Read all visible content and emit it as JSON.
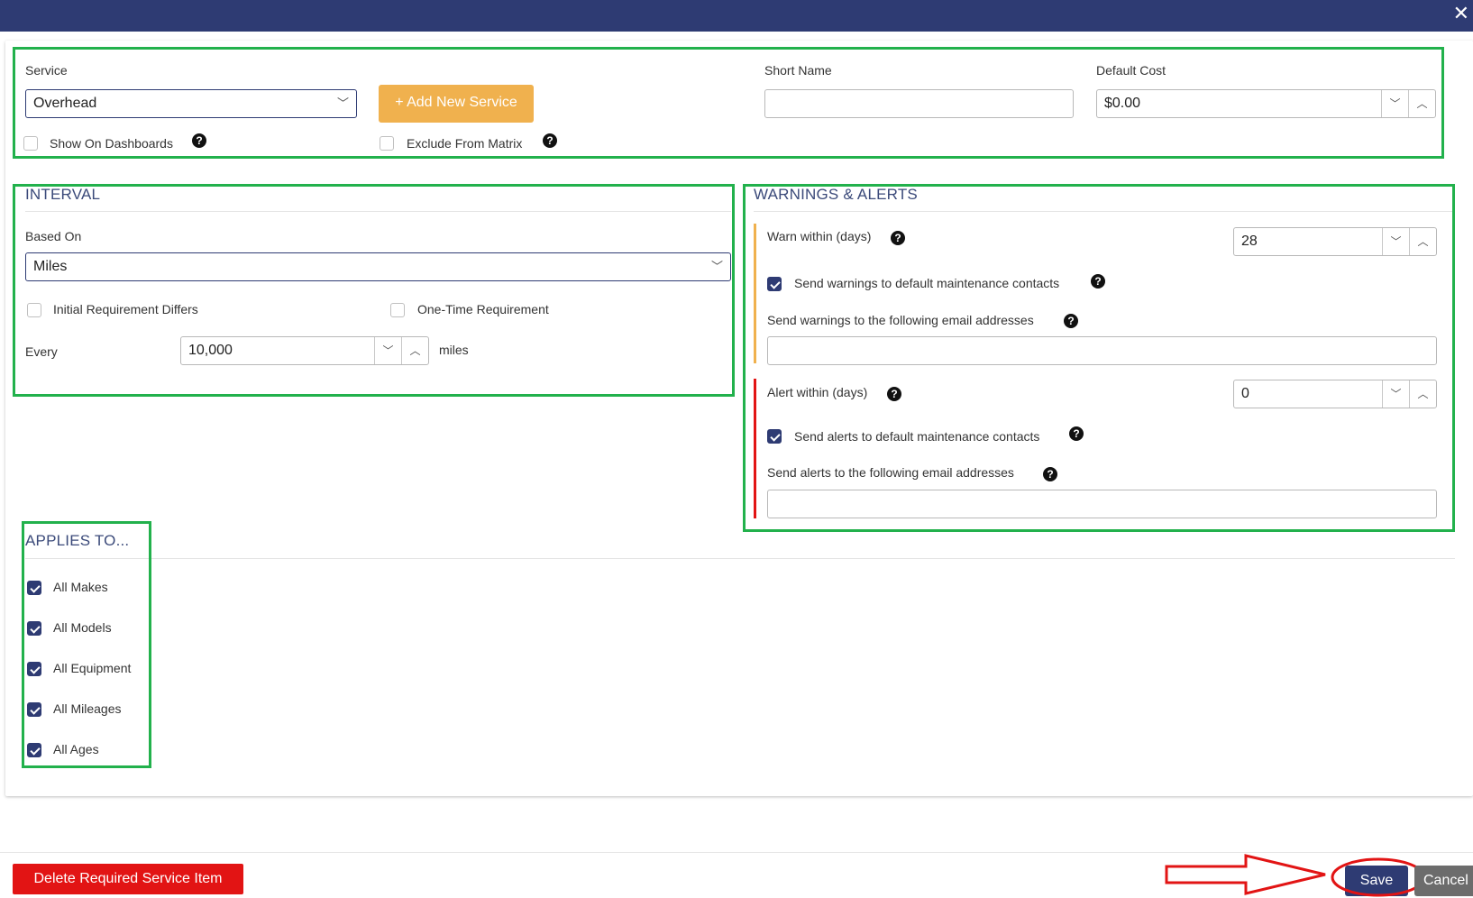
{
  "close_glyph": "✕",
  "service": {
    "label": "Service",
    "value": "Overhead",
    "add_button": "+ Add New Service",
    "short_name_label": "Short Name",
    "short_name_value": "",
    "default_cost_label": "Default Cost",
    "default_cost_value": "$0.00",
    "show_on_dashboards": "Show On Dashboards",
    "exclude_from_matrix": "Exclude From Matrix"
  },
  "interval": {
    "title": "INTERVAL",
    "based_on_label": "Based On",
    "based_on_value": "Miles",
    "initial_requirement": "Initial Requirement Differs",
    "one_time": "One-Time Requirement",
    "every_label": "Every",
    "every_value": "10,000",
    "unit": "miles"
  },
  "warnings": {
    "title": "WARNINGS & ALERTS",
    "warn_label": "Warn within (days)",
    "warn_value": "28",
    "send_warnings_default": "Send warnings to default maintenance contacts",
    "send_warnings_emails": "Send warnings to the following email addresses",
    "alert_label": "Alert within (days)",
    "alert_value": "0",
    "send_alerts_default": "Send alerts to default maintenance contacts",
    "send_alerts_emails": "Send alerts to the following email addresses"
  },
  "applies": {
    "title": "APPLIES TO...",
    "items": [
      "All Makes",
      "All Models",
      "All Equipment",
      "All Mileages",
      "All Ages"
    ]
  },
  "footer": {
    "delete": "Delete Required Service Item",
    "save": "Save",
    "cancel": "Cancel"
  },
  "icons": {
    "help": "?",
    "chevron_down": "﹀",
    "chevron_up": "︿"
  },
  "colors": {
    "header": "#2e3b73",
    "accent_orange": "#f0b14e",
    "danger": "#e21414",
    "highlight_green": "#22b14c",
    "annotation_red": "#e21414"
  }
}
